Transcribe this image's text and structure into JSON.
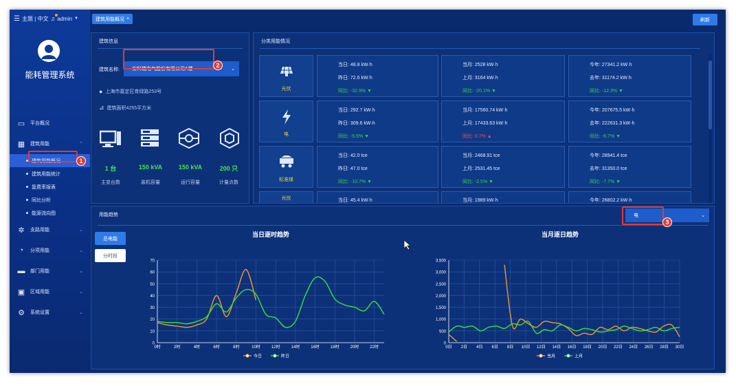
{
  "header": {
    "menu_text": "主题 | 中文",
    "user": "admin",
    "tab_label": "建筑用能概况",
    "tab_close": "×",
    "refresh_label": "刷新"
  },
  "sidebar": {
    "title": "能耗管理系统",
    "items": [
      {
        "label": "平台概况"
      },
      {
        "label": "建筑用能"
      },
      {
        "label": "支路用能"
      },
      {
        "label": "分项用能"
      },
      {
        "label": "部门用能"
      },
      {
        "label": "区域用能"
      },
      {
        "label": "系统设置"
      }
    ],
    "sub_items": [
      {
        "label": "建筑用能概况"
      },
      {
        "label": "建筑用能统计"
      },
      {
        "label": "复费率报表"
      },
      {
        "label": "同比分析"
      },
      {
        "label": "能源流向图"
      }
    ]
  },
  "building": {
    "panel_title": "建筑信息",
    "name_label": "建筑名称:",
    "name_value": "安科瑞电气股份有限公司A楼",
    "address": "上海市嘉定区育绿路253号",
    "area": "建筑面积4255平方米",
    "kpis": [
      {
        "value": "1 台",
        "label": "主变台数"
      },
      {
        "value": "150 kVA",
        "label": "装机容量"
      },
      {
        "value": "150 kVA",
        "label": "运行容量"
      },
      {
        "value": "200 只",
        "label": "计量点数"
      }
    ]
  },
  "category": {
    "panel_title": "分类用能情况",
    "rows": [
      {
        "name": "光伏",
        "today": "当日: 48.8 kW·h",
        "yesterday": "昨日: 72.6 kW·h",
        "yoy1": "同比: -32.9%",
        "month": "当月: 2528 kW·h",
        "last_month": "上月: 3164 kW·h",
        "yoy2": "同比: -20.1%",
        "year": "今年: 27341.2 kW·h",
        "last_year": "去年: 31174.2 kW·h",
        "yoy3": "同比: -12.3%",
        "dirs": [
          "down",
          "down",
          "down"
        ]
      },
      {
        "name": "电",
        "today": "当日: 292.7 kW·h",
        "yesterday": "昨日: 309.6 kW·h",
        "yoy1": "同比: -5.5%",
        "month": "当月: 17560.74 kW·h",
        "last_month": "上月: 17433.63 kW·h",
        "yoy2": "同比: 0.7%",
        "year": "今年: 207675.5 kW·h",
        "last_year": "去年: 222631.3 kW·h",
        "yoy3": "同比: -6.7%",
        "dirs": [
          "down",
          "up",
          "down"
        ]
      },
      {
        "name": "标准煤",
        "today": "当日: 42.0 tce",
        "yesterday": "昨日: 47.0 tce",
        "yoy1": "同比: -10.7%",
        "month": "当月: 2468.91 tce",
        "last_month": "上月: 2531.45 tce",
        "yoy2": "同比: -2.5%",
        "year": "今年: 28941.4 tce",
        "last_year": "去年: 31350.0 tce",
        "yoy3": "同比: -7.7%",
        "dirs": [
          "down",
          "down",
          "down"
        ]
      },
      {
        "name": "光伏",
        "today": "当日: 45.4 kW·h",
        "yesterday": "",
        "yoy1": "",
        "month": "当月: 1989 kW·h",
        "last_month": "",
        "yoy2": "",
        "year": "今年: 26802.2 kW·h",
        "last_year": "",
        "yoy3": "",
        "dirs": [
          "",
          "",
          ""
        ]
      }
    ]
  },
  "trend": {
    "panel_title": "用能趋势",
    "select_value": "电",
    "btn_total": "总电能",
    "btn_period": "分时段"
  },
  "markers": [
    "1",
    "2",
    "3"
  ],
  "chart_data": [
    {
      "type": "line",
      "title": "当日逐时趋势",
      "x": [
        "0时",
        "1时",
        "2时",
        "3时",
        "4时",
        "5时",
        "6时",
        "7时",
        "8时",
        "9时",
        "10时",
        "11时",
        "12时",
        "13时",
        "14时",
        "15时",
        "16时",
        "17时",
        "18时",
        "19时",
        "20时",
        "21时",
        "22时",
        "23时"
      ],
      "x_tick_labels": [
        "0时",
        "2时",
        "4时",
        "6时",
        "8时",
        "10时",
        "12时",
        "14时",
        "16时",
        "18时",
        "20时",
        "22时"
      ],
      "ylim": [
        0,
        70
      ],
      "y_ticks": [
        0,
        10,
        20,
        30,
        40,
        50,
        60,
        70
      ],
      "series": [
        {
          "name": "今日",
          "color": "#e8922e",
          "values": [
            17,
            15,
            14,
            13,
            15,
            20,
            40,
            22,
            42,
            62,
            36
          ]
        },
        {
          "name": "昨日",
          "color": "#3ad83a",
          "values": [
            18,
            17,
            17,
            16,
            18,
            22,
            33,
            26,
            38,
            45,
            41,
            24,
            21,
            13,
            18,
            40,
            55,
            52,
            37,
            32,
            30,
            27,
            35,
            24
          ]
        }
      ],
      "grid": true,
      "legend": "bottom"
    },
    {
      "type": "line",
      "title": "当月逐日趋势",
      "x": [
        "1日",
        "2日",
        "3日",
        "4日",
        "5日",
        "6日",
        "7日",
        "8日",
        "9日",
        "10日",
        "11日",
        "12日",
        "13日",
        "14日",
        "15日",
        "16日",
        "17日",
        "18日",
        "19日",
        "20日",
        "21日",
        "22日",
        "23日",
        "24日",
        "25日",
        "26日",
        "27日",
        "28日",
        "29日",
        "30日",
        "31日"
      ],
      "x_tick_labels": [
        "0日",
        "2日",
        "4日",
        "6日",
        "8日",
        "10日",
        "12日",
        "14日",
        "16日",
        "18日",
        "20日",
        "22日",
        "24日",
        "26日",
        "28日",
        "30日"
      ],
      "ylim": [
        0,
        3500
      ],
      "y_ticks": [
        0,
        500,
        1000,
        1500,
        2000,
        2500,
        3000,
        3500
      ],
      "y_tick_labels": [
        "0",
        "500",
        "1,000",
        "1,500",
        "2,000",
        "2,500",
        "3,000",
        "3,500"
      ],
      "series": [
        {
          "name": "当月",
          "color": "#e8922e",
          "values": [
            350,
            50,
            null,
            null,
            null,
            null,
            null,
            3300,
            700,
            1000,
            800,
            650,
            900,
            850,
            800,
            600,
            300,
            400,
            350,
            650,
            550,
            700,
            500,
            650,
            600,
            500,
            450,
            700,
            750,
            250
          ]
        },
        {
          "name": "上月",
          "color": "#3ad83a",
          "values": [
            450,
            700,
            650,
            700,
            500,
            650,
            700,
            600,
            800,
            750,
            900,
            400,
            550,
            500,
            750,
            650,
            500,
            600,
            550,
            450,
            500,
            550,
            700,
            600,
            500,
            550,
            650,
            500,
            600,
            650
          ]
        }
      ],
      "grid": true,
      "legend": "bottom"
    }
  ]
}
